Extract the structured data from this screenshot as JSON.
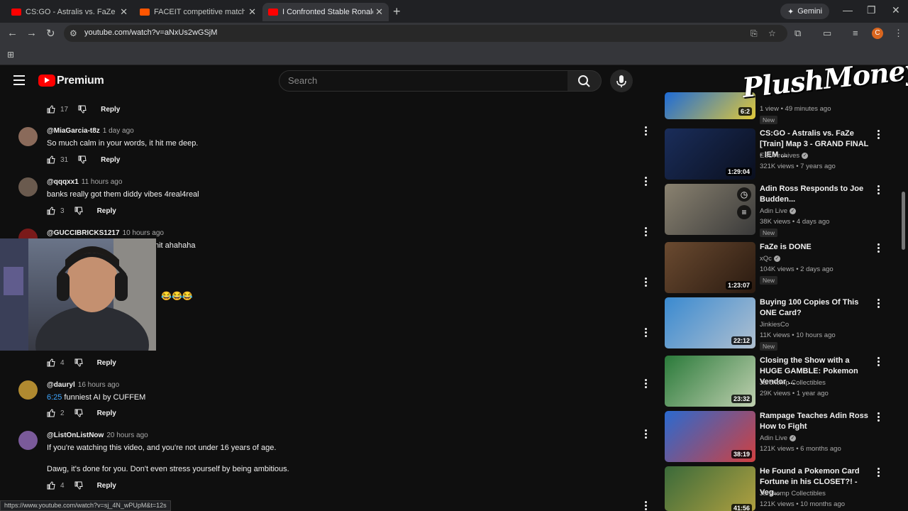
{
  "browser": {
    "tabs": [
      {
        "title": "CS:GO - Astralis vs. FaZe [Cache] M",
        "favicon_color": "#ff0000",
        "active": false
      },
      {
        "title": "FACEIT competitive match - FACEIT",
        "favicon_color": "#ff5500",
        "active": false
      },
      {
        "title": "I Confronted Stable Ronaldo on Fa",
        "favicon_color": "#ff0000",
        "active": true
      }
    ],
    "gemini_label": "Gemini",
    "url": "youtube.com/watch?v=aNxUs2wGSjM",
    "profile_initial": "C",
    "status_url": "https://www.youtube.com/watch?v=sj_4N_wPUpM&t=12s"
  },
  "header": {
    "logo_text": "Premium",
    "search_placeholder": "Search",
    "overlay_brand": "PlushMoney"
  },
  "comments": [
    {
      "author": "",
      "time": "",
      "text": "",
      "likes": "17"
    },
    {
      "author": "@MiaGarcia-t8z",
      "time": "1 day ago",
      "text": "So much calm in your words, it hit me deep.",
      "likes": "31",
      "avatar_color": "#8a6a5a"
    },
    {
      "author": "@qqqxx1",
      "time": "11 hours ago",
      "text": "banks really got them diddy vibes 4real4real",
      "likes": "3",
      "avatar_color": "#6a5a4e"
    },
    {
      "author": "@GUCCIBRICKS1217",
      "time": "10 hours ago",
      "text": "nit ahahaha",
      "extra": "😂😂😂",
      "likes": "4",
      "avatar_color": "#7a1a1a"
    },
    {
      "author": "@dauryl",
      "time": "16 hours ago",
      "timestamp": "6:25",
      "text": "funniest AI by CUFFEM",
      "likes": "2",
      "avatar_color": "#b08a30"
    },
    {
      "author": "@ListOnListNow",
      "time": "20 hours ago",
      "text": "If you're watching this video, and you're not under 16 years of age.",
      "text2": "Dawg, it's done for you. Don't even stress yourself by being ambitious.",
      "likes": "4",
      "avatar_color": "#7a5a9a"
    }
  ],
  "reply_label": "Reply",
  "sidebar": [
    {
      "title": "",
      "channel": "",
      "meta": "1 view • 49 minutes ago",
      "badge": "New",
      "duration": "6:2",
      "thumb_colors": [
        "#1e6bd6",
        "#e0c83a"
      ]
    },
    {
      "title": "CS:GO - Astralis vs. FaZe [Train] Map 3 - GRAND FINAL - IEM ...",
      "channel": "ESL Archives",
      "verified": true,
      "meta": "321K views • 7 years ago",
      "duration": "1:29:04",
      "thumb_colors": [
        "#1a2d5a",
        "#0a0f1e"
      ]
    },
    {
      "title": "Adin Ross Responds to Joe Budden...",
      "channel": "Adin Live",
      "verified": true,
      "meta": "38K views • 4 days ago",
      "badge": "New",
      "duration": "",
      "thumb_colors": [
        "#8a8270",
        "#3a3a3a"
      ]
    },
    {
      "title": "FaZe is DONE",
      "channel": "xQc",
      "verified": true,
      "meta": "104K views • 2 days ago",
      "badge": "New",
      "duration": "1:23:07",
      "thumb_colors": [
        "#6a4a30",
        "#2a1a10"
      ]
    },
    {
      "title": "Buying 100 Copies Of This ONE Card?",
      "channel": "JinkiesCo",
      "verified": false,
      "meta": "11K views • 10 hours ago",
      "badge": "New",
      "duration": "22:12",
      "thumb_colors": [
        "#3a8ad0",
        "#b0c0d0"
      ]
    },
    {
      "title": "Closing the Show with a HUGE GAMBLE: Pokemon Vendor ...",
      "channel": "Jarchomp Collectibles",
      "verified": false,
      "meta": "29K views • 1 year ago",
      "duration": "23:32",
      "thumb_colors": [
        "#2a7a3a",
        "#c0d0b0"
      ]
    },
    {
      "title": "Rampage Teaches Adin Ross How to Fight",
      "channel": "Adin Live",
      "verified": true,
      "meta": "121K views • 6 months ago",
      "duration": "38:19",
      "thumb_colors": [
        "#2a6ad0",
        "#d04040"
      ]
    },
    {
      "title": "He Found a Pokemon Card Fortune in his CLOSET?! - Veg...",
      "channel": "Jarchomp Collectibles",
      "verified": false,
      "meta": "121K views • 10 months ago",
      "duration": "41:56",
      "thumb_colors": [
        "#3a6a3a",
        "#b0a040"
      ]
    }
  ]
}
